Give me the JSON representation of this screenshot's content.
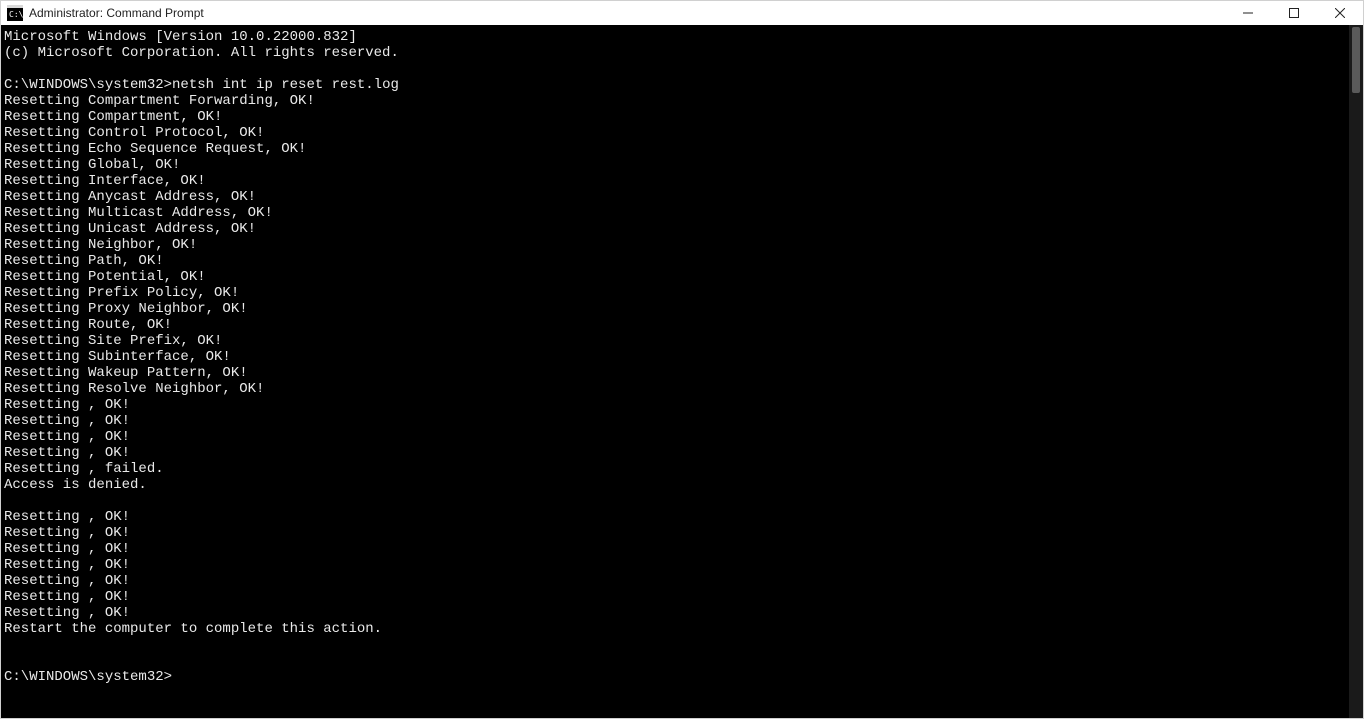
{
  "window": {
    "title": "Administrator: Command Prompt"
  },
  "terminal": {
    "prompt": "C:\\WINDOWS\\system32>",
    "command": "netsh int ip reset rest.log",
    "header_lines": [
      "Microsoft Windows [Version 10.0.22000.832]",
      "(c) Microsoft Corporation. All rights reserved.",
      ""
    ],
    "output_lines": [
      "Resetting Compartment Forwarding, OK!",
      "Resetting Compartment, OK!",
      "Resetting Control Protocol, OK!",
      "Resetting Echo Sequence Request, OK!",
      "Resetting Global, OK!",
      "Resetting Interface, OK!",
      "Resetting Anycast Address, OK!",
      "Resetting Multicast Address, OK!",
      "Resetting Unicast Address, OK!",
      "Resetting Neighbor, OK!",
      "Resetting Path, OK!",
      "Resetting Potential, OK!",
      "Resetting Prefix Policy, OK!",
      "Resetting Proxy Neighbor, OK!",
      "Resetting Route, OK!",
      "Resetting Site Prefix, OK!",
      "Resetting Subinterface, OK!",
      "Resetting Wakeup Pattern, OK!",
      "Resetting Resolve Neighbor, OK!",
      "Resetting , OK!",
      "Resetting , OK!",
      "Resetting , OK!",
      "Resetting , OK!",
      "Resetting , failed.",
      "Access is denied.",
      "",
      "Resetting , OK!",
      "Resetting , OK!",
      "Resetting , OK!",
      "Resetting , OK!",
      "Resetting , OK!",
      "Resetting , OK!",
      "Resetting , OK!",
      "Restart the computer to complete this action.",
      "",
      ""
    ]
  }
}
